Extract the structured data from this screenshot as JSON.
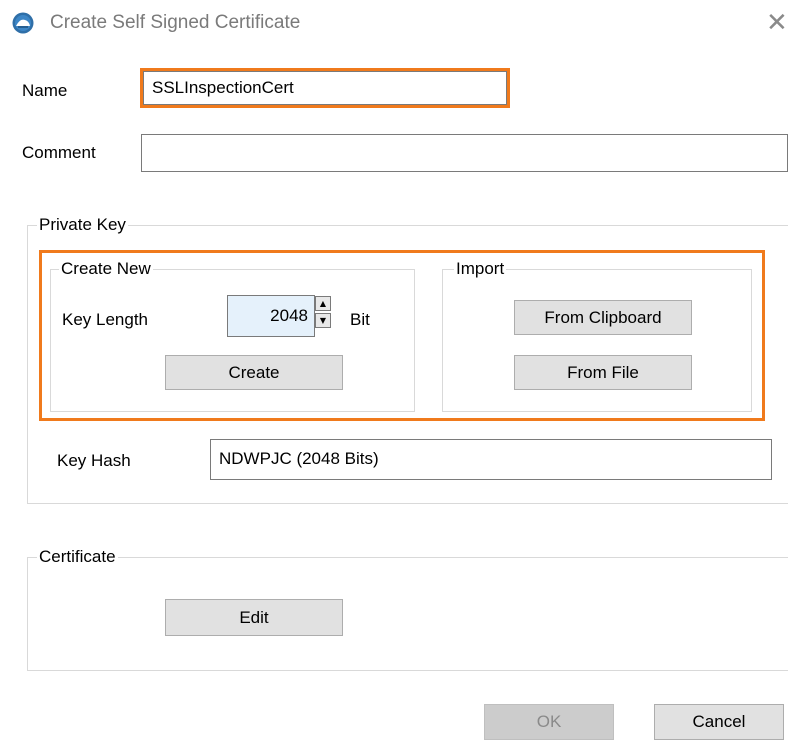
{
  "window": {
    "title": "Create Self Signed Certificate",
    "close_glyph": "✕",
    "icon": "app-logo-icon"
  },
  "form": {
    "name_label": "Name",
    "name_value": "SSLInspectionCert",
    "comment_label": "Comment",
    "comment_value": ""
  },
  "private_key": {
    "group_label": "Private Key",
    "create_new": {
      "group_label": "Create New",
      "key_length_label": "Key Length",
      "key_length_value": "2048",
      "unit_label": "Bit",
      "create_button": "Create"
    },
    "import": {
      "group_label": "Import",
      "from_clipboard_button": "From Clipboard",
      "from_file_button": "From File"
    },
    "key_hash_label": "Key Hash",
    "key_hash_value": "NDWPJC (2048 Bits)"
  },
  "certificate": {
    "group_label": "Certificate",
    "edit_button": "Edit"
  },
  "footer": {
    "ok_button": "OK",
    "cancel_button": "Cancel"
  },
  "colors": {
    "highlight": "#f07a1c",
    "button_bg": "#e1e1e1",
    "spin_bg": "#e5f1fb"
  }
}
